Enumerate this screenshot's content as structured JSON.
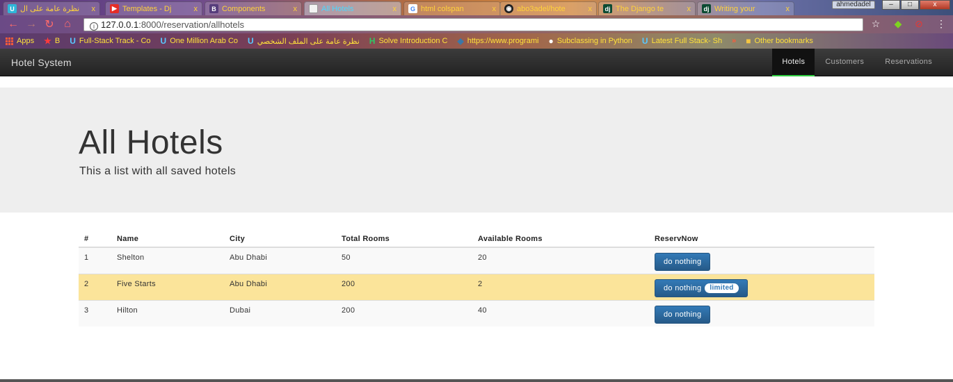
{
  "browser": {
    "tabs": [
      {
        "title": "نظرة عامة على ال",
        "favicon": "udacity-icon",
        "favicon_color": "#2fb6d9"
      },
      {
        "title": "Templates - Dj",
        "favicon": "youtube-icon",
        "favicon_color": "#e52d27"
      },
      {
        "title": "Components",
        "favicon": "bootstrap-icon",
        "favicon_color": "#563d7c"
      },
      {
        "title": "All Hotels",
        "favicon": "document-icon",
        "favicon_color": "#dddddd",
        "active": true
      },
      {
        "title": "html colspan",
        "favicon": "google-icon",
        "favicon_color": "#ffffff"
      },
      {
        "title": "abo3adel/hote",
        "favicon": "github-icon",
        "favicon_color": "#222222"
      },
      {
        "title": "The Django te",
        "favicon": "django-icon",
        "favicon_color": "#0c4b33"
      },
      {
        "title": "Writing your",
        "favicon": "django-icon",
        "favicon_color": "#0c4b33"
      }
    ],
    "user": "ahmedadel",
    "window_buttons": {
      "minimize": "–",
      "maximize": "□",
      "close": "x"
    },
    "url_host": "127.0.0.1",
    "url_path": ":8000/reservation/allhotels",
    "bookmarks": [
      {
        "label": "Apps",
        "icon": "apps-grid-icon"
      },
      {
        "label": "B",
        "icon": "star-icon"
      },
      {
        "label": "Full-Stack Track - Co",
        "icon": "udacity-icon"
      },
      {
        "label": "One Million Arab Co",
        "icon": "udacity-icon"
      },
      {
        "label": "نظرة عامة على الملف الشخصي",
        "icon": "udacity-icon"
      },
      {
        "label": "Solve Introduction C",
        "icon": "hackerrank-icon"
      },
      {
        "label": "https://www.programi",
        "icon": "python-icon"
      },
      {
        "label": "Subclassing in Python",
        "icon": "python-icon"
      },
      {
        "label": "Latest Full Stack- Sh",
        "icon": "udacity-icon"
      },
      {
        "label": "»",
        "icon": ""
      },
      {
        "label": "Other bookmarks",
        "icon": "folder-icon"
      }
    ]
  },
  "navbar": {
    "brand": "Hotel System",
    "links": [
      {
        "label": "Hotels",
        "active": true
      },
      {
        "label": "Customers",
        "active": false
      },
      {
        "label": "Reservations",
        "active": false
      }
    ]
  },
  "jumbotron": {
    "title": "All Hotels",
    "subtitle": "This a list with all saved hotels"
  },
  "table": {
    "headers": [
      "#",
      "Name",
      "City",
      "Total Rooms",
      "Available Rooms",
      "ReservNow"
    ],
    "rows": [
      {
        "num": "1",
        "name": "Shelton",
        "city": "Abu Dhabi",
        "total": "50",
        "available": "20",
        "button": "do nothing",
        "badge": ""
      },
      {
        "num": "2",
        "name": "Five Starts",
        "city": "Abu Dhabi",
        "total": "200",
        "available": "2",
        "button": "do nothing",
        "badge": "limited"
      },
      {
        "num": "3",
        "name": "Hilton",
        "city": "Dubai",
        "total": "200",
        "available": "40",
        "button": "do nothing",
        "badge": ""
      }
    ]
  },
  "colors": {
    "primary": "#337ab7",
    "warning_row": "#fbe49a",
    "nav_active_border": "#2ecc40"
  }
}
